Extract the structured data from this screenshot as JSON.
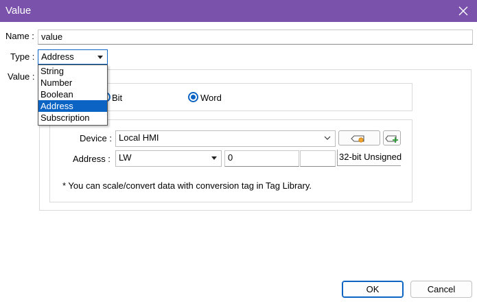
{
  "window": {
    "title": "Value"
  },
  "form": {
    "name_label": "Name :",
    "name_value": "value",
    "type_label": "Type :",
    "type_value": "Address",
    "value_label": "Value :"
  },
  "type_dropdown": {
    "options": [
      "String",
      "Number",
      "Boolean",
      "Address",
      "Subscription"
    ],
    "selected": "Address"
  },
  "data_kind": {
    "bit_label": "Bit",
    "word_label": "Word",
    "selected": "Word"
  },
  "device": {
    "label": "Device :",
    "value": "Local HMI"
  },
  "address": {
    "label": "Address :",
    "register": "LW",
    "value": "0",
    "extra": "",
    "format": "32-bit Unsigned"
  },
  "note": "* You can scale/convert data with conversion tag in Tag Library.",
  "buttons": {
    "ok": "OK",
    "cancel": "Cancel"
  },
  "colors": {
    "titlebar": "#7b52ab",
    "accent": "#0b63c4"
  }
}
